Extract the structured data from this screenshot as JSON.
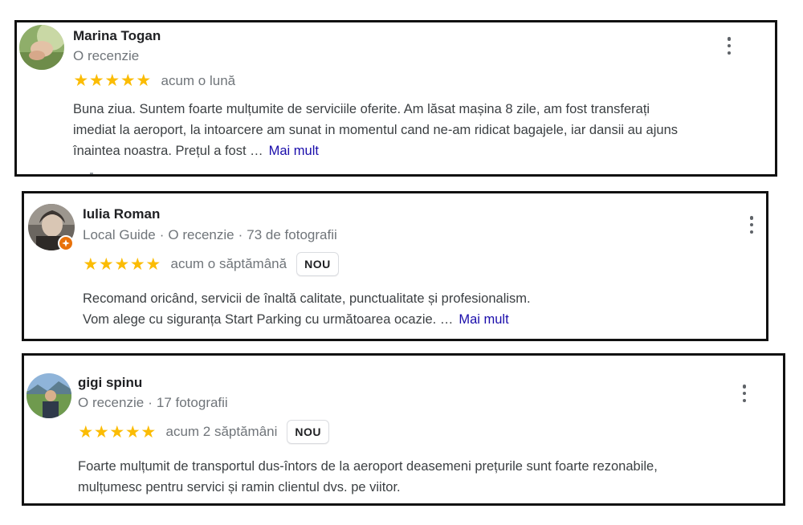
{
  "reviews": [
    {
      "name": "Marina Togan",
      "meta": [
        "O recenzie"
      ],
      "stars": 5,
      "time": "acum o lună",
      "badge": "",
      "text_lines": [
        "Buna ziua. Suntem foarte mulțumite de serviciile oferite. Am lăsat mașina 8 zile, am fost transferați",
        "imediat la aeroport, la intoarcere am sunat in momentul cand ne-am ridicat bagajele, iar dansii au ajuns",
        "înaintea noastra. Prețul a fost …"
      ],
      "more_label": "Mai mult",
      "avatar_icon": "avatar-photo-hand"
    },
    {
      "name": "Iulia Roman",
      "meta": [
        "Local Guide",
        "O recenzie",
        "73 de fotografii"
      ],
      "stars": 5,
      "time": "acum o săptămână",
      "badge": "NOU",
      "text_lines": [
        "Recomand oricând, servicii de înaltă calitate, punctualitate și profesionalism.",
        "Vom alege cu siguranța Start Parking cu următoarea ocazie. …"
      ],
      "more_label": "Mai mult",
      "avatar_icon": "avatar-photo-portrait",
      "local_guide_icon": "local-guide-badge-icon"
    },
    {
      "name": "gigi spinu",
      "meta": [
        "O recenzie",
        "17 fotografii"
      ],
      "stars": 5,
      "time": "acum 2 săptămâni",
      "badge": "NOU",
      "text_lines": [
        "Foarte mulțumit de transportul dus-întors de la aeroport deasemeni prețurile sunt foarte rezonabile,",
        "mulțumesc pentru servici și ramin clientul dvs. pe viitor."
      ],
      "more_label": "",
      "avatar_icon": "avatar-photo-landscape"
    }
  ],
  "colors": {
    "star": "#fbbc04",
    "link": "#1a0dab",
    "meta": "#70757a",
    "local_guide": "#e8710a"
  }
}
